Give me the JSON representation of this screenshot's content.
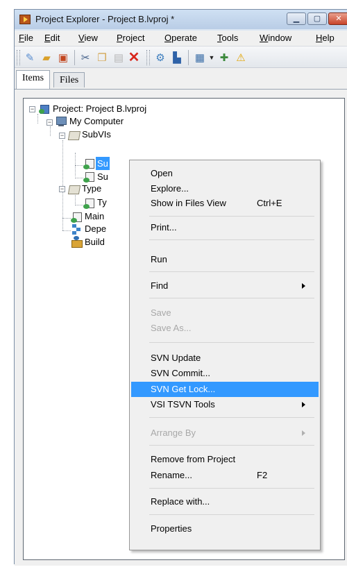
{
  "window": {
    "title": "Project Explorer - Project B.lvproj *",
    "controls": {
      "minimize_icon": "minimize-icon",
      "maximize_icon": "maximize-icon",
      "close_icon": "close-icon"
    }
  },
  "menubar": {
    "items": [
      {
        "label": "File",
        "accel": "F",
        "rest": "ile"
      },
      {
        "label": "Edit",
        "accel": "E",
        "rest": "dit"
      },
      {
        "label": "View",
        "accel": "V",
        "rest": "iew"
      },
      {
        "label": "Project",
        "accel": "P",
        "rest": "roject"
      },
      {
        "label": "Operate",
        "accel": "O",
        "rest": "perate"
      },
      {
        "label": "Tools",
        "accel": "T",
        "rest": "ools"
      },
      {
        "label": "Window",
        "accel": "W",
        "rest": "indow"
      },
      {
        "label": "Help",
        "accel": "H",
        "rest": "elp"
      }
    ]
  },
  "toolbar": {
    "icons": [
      "new-icon",
      "open-icon",
      "save-all-icon",
      "cut-icon",
      "copy-icon",
      "paste-icon",
      "delete-icon",
      "project-properties-icon",
      "build-icon",
      "view-dropdown-icon",
      "add-file-icon",
      "warning-icon"
    ]
  },
  "tabs": [
    {
      "label": "Items",
      "active": true
    },
    {
      "label": "Files",
      "active": false
    }
  ],
  "tree": {
    "project": "Project: Project B.lvproj",
    "my_computer": "My Computer",
    "subvis_folder": "SubVIs",
    "subvi_1": "Su",
    "subvi_2": "Su",
    "typedefs_folder": "Type",
    "typedef_1": "Ty",
    "main_vi": "Main",
    "dependencies": "Depe",
    "build_specs": "Build"
  },
  "context_menu": {
    "open": "Open",
    "explore": "Explore...",
    "show_in_files_view": "Show in Files View",
    "show_in_files_view_shortcut": "Ctrl+E",
    "print": "Print...",
    "run": "Run",
    "find": "Find",
    "save": "Save",
    "save_as": "Save As...",
    "svn_update": "SVN Update",
    "svn_commit": "SVN Commit...",
    "svn_get_lock": "SVN Get Lock...",
    "vsi_tsvn_tools": "VSI TSVN Tools",
    "arrange_by": "Arrange By",
    "remove_from_project": "Remove from Project",
    "rename": "Rename...",
    "rename_shortcut": "F2",
    "replace_with": "Replace with...",
    "properties": "Properties"
  }
}
